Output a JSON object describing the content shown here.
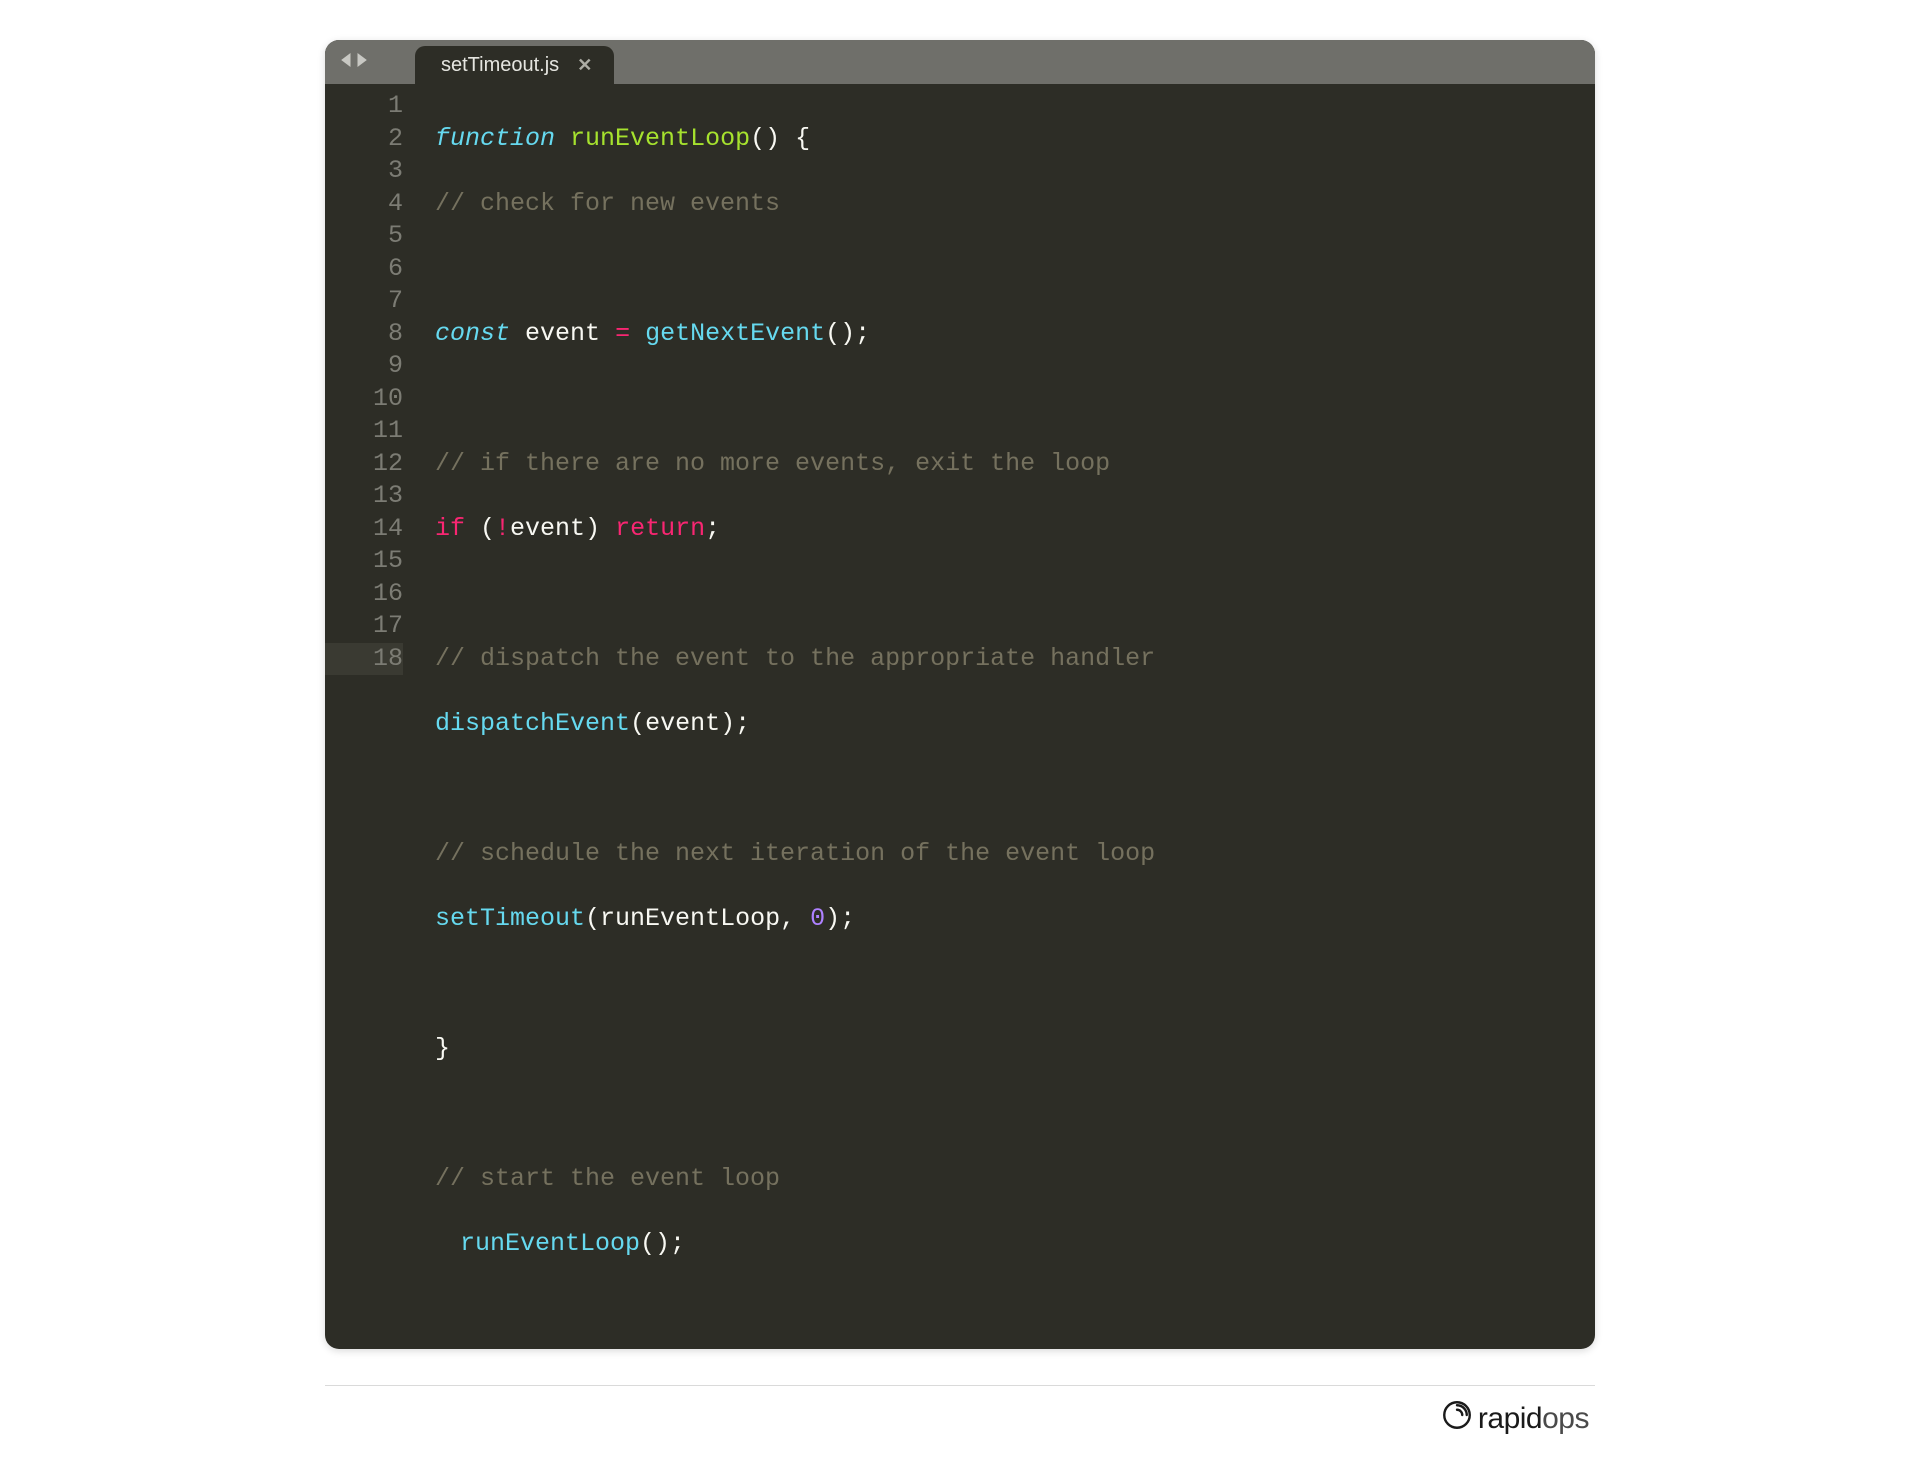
{
  "tab": {
    "filename": "setTimeout.js"
  },
  "gutter": {
    "lines": [
      "1",
      "2",
      "3",
      "4",
      "5",
      "6",
      "7",
      "8",
      "9",
      "10",
      "11",
      "12",
      "13",
      "14",
      "15",
      "16",
      "17",
      "18"
    ],
    "highlighted": 18
  },
  "code": {
    "l1": {
      "kw": "function",
      "name": "runEventLoop",
      "tail": "() {"
    },
    "l2": {
      "comment": "// check for new events"
    },
    "l4": {
      "kw": "const",
      "ident": "event",
      "op": "=",
      "call": "getNextEvent",
      "tail": "();"
    },
    "l6": {
      "comment": "// if there are no more events, exit the loop"
    },
    "l7": {
      "kw_if": "if",
      "open": " (",
      "bang": "!",
      "ident": "event",
      "close": ") ",
      "kw_ret": "return",
      "semi": ";"
    },
    "l9": {
      "comment": "// dispatch the event to the appropriate handler"
    },
    "l10": {
      "call": "dispatchEvent",
      "open": "(",
      "arg": "event",
      "close": ");"
    },
    "l12": {
      "comment": "// schedule the next iteration of the event loop"
    },
    "l13": {
      "call": "setTimeout",
      "open": "(",
      "arg1": "runEventLoop",
      "comma": ", ",
      "num": "0",
      "close": ");"
    },
    "l15": {
      "brace": "}"
    },
    "l17": {
      "comment": "// start the event loop"
    },
    "l18": {
      "call": "runEventLoop",
      "tail": "();"
    }
  },
  "brand": {
    "bold": "rapid",
    "light": "ops"
  }
}
